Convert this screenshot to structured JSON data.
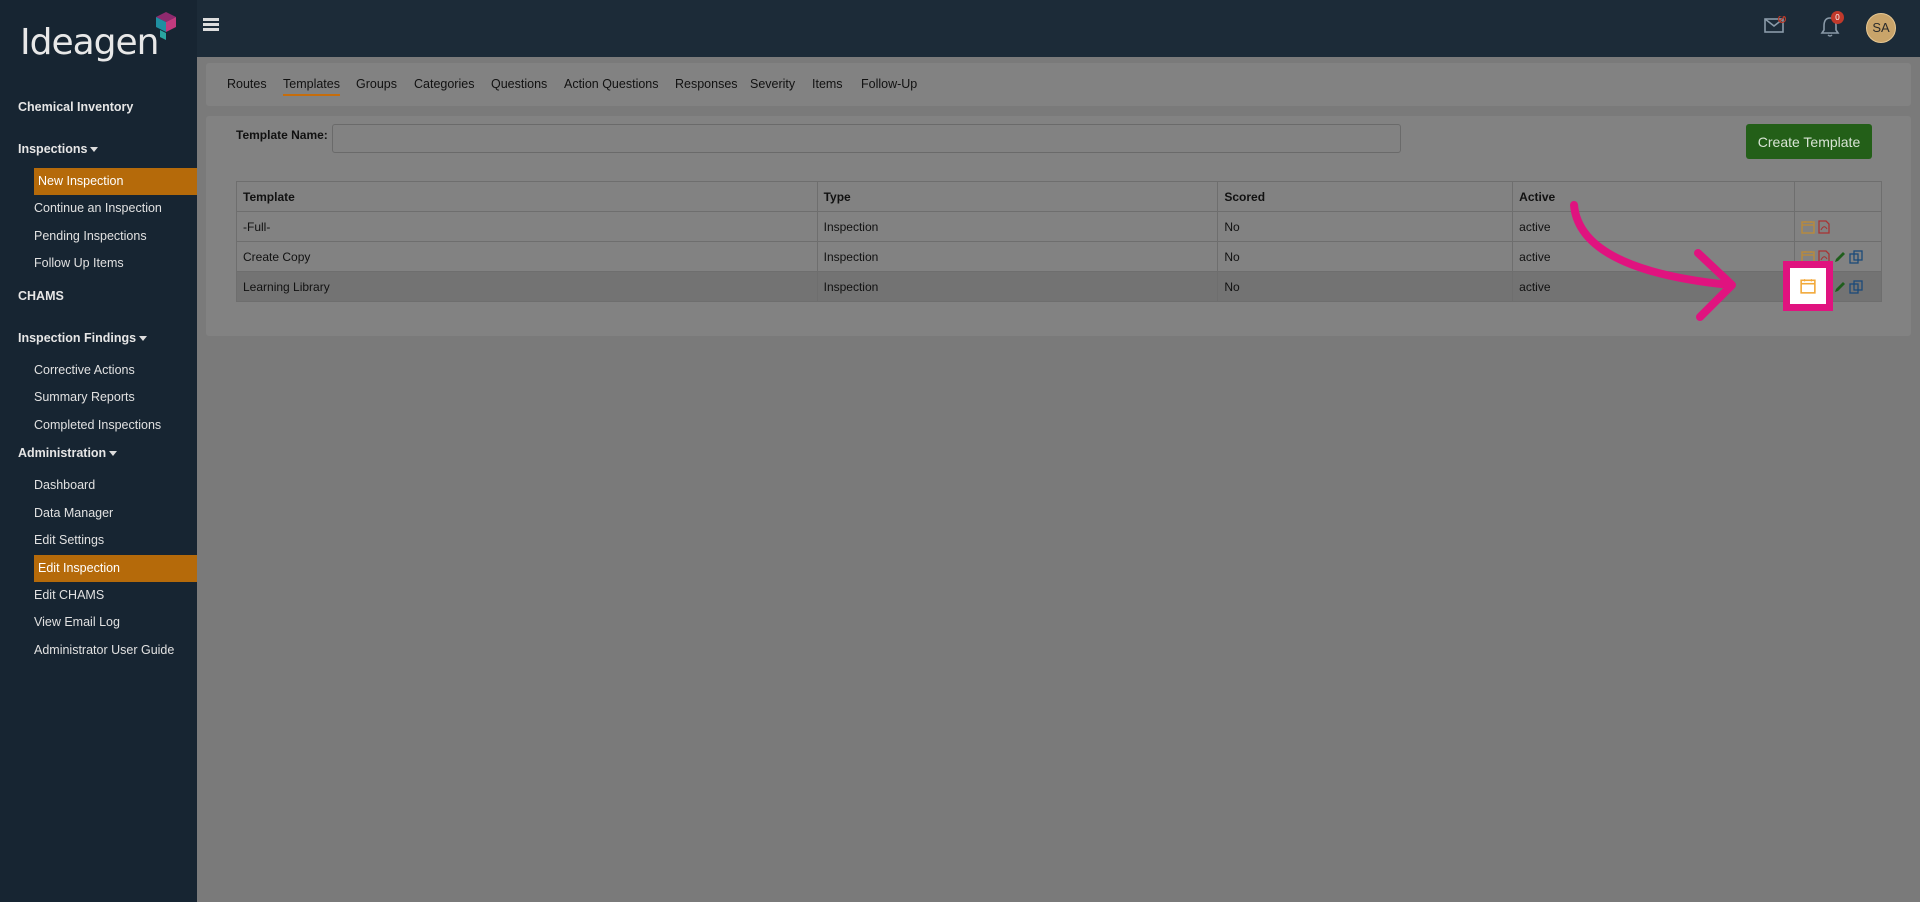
{
  "brand": {
    "name": "Ideagen"
  },
  "sidebar": {
    "sections": [
      {
        "label": "Chemical Inventory",
        "has_caret": false,
        "items": []
      },
      {
        "label": "Inspections",
        "has_caret": true,
        "items": [
          {
            "label": "New Inspection",
            "active": true
          },
          {
            "label": "Continue an Inspection"
          },
          {
            "label": "Pending Inspections"
          },
          {
            "label": "Follow Up Items"
          }
        ]
      },
      {
        "label": "CHAMS",
        "has_caret": false,
        "items": []
      },
      {
        "label": "Inspection Findings",
        "has_caret": true,
        "items": [
          {
            "label": "Corrective Actions"
          },
          {
            "label": "Summary Reports"
          },
          {
            "label": "Completed Inspections"
          }
        ]
      },
      {
        "label": "Administration",
        "has_caret": true,
        "items": [
          {
            "label": "Dashboard"
          },
          {
            "label": "Data Manager"
          },
          {
            "label": "Edit Settings"
          },
          {
            "label": "Edit Inspection",
            "active": true
          },
          {
            "label": "Edit CHAMS"
          },
          {
            "label": "View Email Log"
          },
          {
            "label": "Administrator User Guide"
          }
        ]
      }
    ]
  },
  "topbar": {
    "notifications_count": "0",
    "avatar_initials": "SA"
  },
  "tabs": [
    "Routes",
    "Templates",
    "Groups",
    "Categories",
    "Questions",
    "Action Questions",
    "Responses",
    "Severity",
    "Items",
    "Follow-Up"
  ],
  "active_tab": "Templates",
  "form": {
    "template_name_label": "Template Name:",
    "template_name_value": "",
    "create_button": "Create Template"
  },
  "table": {
    "columns": [
      "Template",
      "Type",
      "Scored",
      "Active"
    ],
    "rows": [
      {
        "template": "-Full-",
        "type": "Inspection",
        "scored": "No",
        "active": "active",
        "actions": [
          "calendar-icon",
          "pdf-icon"
        ]
      },
      {
        "template": "Create Copy",
        "type": "Inspection",
        "scored": "No",
        "active": "active",
        "actions": [
          "calendar-icon",
          "pdf-icon",
          "pencil-icon",
          "copy-icon"
        ]
      },
      {
        "template": "Learning Library",
        "type": "Inspection",
        "scored": "No",
        "active": "active",
        "actions": [
          "calendar-icon",
          "pdf-icon",
          "pencil-icon",
          "copy-icon"
        ],
        "highlighted": true
      }
    ]
  },
  "colors": {
    "sidebar_bg": "#172532",
    "active_item": "#b56a0a",
    "create_button": "#235f18",
    "annotation": "#e0137f",
    "overlay_bg": "#7a7a7a"
  }
}
